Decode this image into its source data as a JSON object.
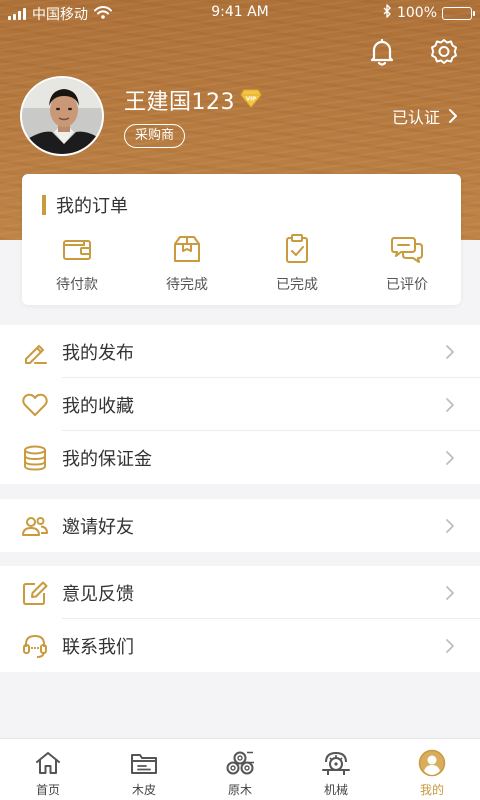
{
  "colors": {
    "accent": "#c99a3e",
    "header_wood": "#b5793f",
    "page_bg": "#f4f4f6"
  },
  "status_bar": {
    "carrier": "中国移动",
    "time": "9:41 AM",
    "battery": "100%",
    "battery_level": 1.0
  },
  "header": {
    "notification_icon": "bell-icon",
    "settings_icon": "gear-icon"
  },
  "profile": {
    "name": "王建国123",
    "vip_badge": "VIP",
    "role": "采购商",
    "verify_status": "已认证"
  },
  "orders": {
    "title": "我的订单",
    "items": [
      {
        "label": "待付款",
        "icon": "wallet-icon"
      },
      {
        "label": "待完成",
        "icon": "package-icon"
      },
      {
        "label": "已完成",
        "icon": "clipboard-check-icon"
      },
      {
        "label": "已评价",
        "icon": "chat-bubbles-icon"
      }
    ]
  },
  "menu_groups": [
    {
      "items": [
        {
          "label": "我的发布",
          "icon": "pencil-icon"
        },
        {
          "label": "我的收藏",
          "icon": "heart-icon"
        },
        {
          "label": "我的保证金",
          "icon": "coins-stack-icon"
        }
      ]
    },
    {
      "items": [
        {
          "label": "邀请好友",
          "icon": "users-icon"
        }
      ]
    },
    {
      "items": [
        {
          "label": "意见反馈",
          "icon": "edit-square-icon"
        },
        {
          "label": "联系我们",
          "icon": "headset-icon"
        }
      ]
    }
  ],
  "tabbar": {
    "active_index": 4,
    "tabs": [
      {
        "label": "首页",
        "icon": "home-icon"
      },
      {
        "label": "木皮",
        "icon": "folder-icon"
      },
      {
        "label": "原木",
        "icon": "logs-icon"
      },
      {
        "label": "机械",
        "icon": "saw-machine-icon"
      },
      {
        "label": "我的",
        "icon": "user-avatar-icon"
      }
    ]
  }
}
